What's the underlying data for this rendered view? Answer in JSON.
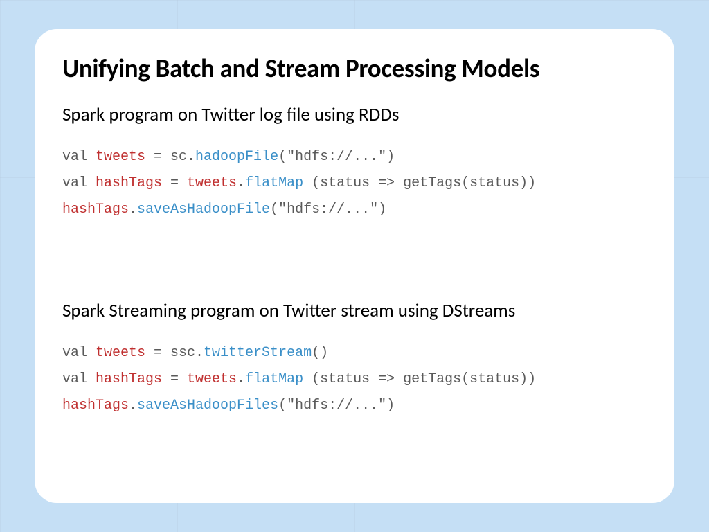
{
  "slide": {
    "title": "Unifying Batch and Stream Processing Models",
    "section1": {
      "subtitle": "Spark program on Twitter log file using RDDs",
      "code": {
        "line1": {
          "p1": "val ",
          "red1": "tweets",
          "p2": " = sc.",
          "blue1": "hadoopFile",
          "p3": "(\"hdfs://...\")"
        },
        "line2": {
          "p1": "val ",
          "red1": "hashTags",
          "p2": " = ",
          "red2": "tweets",
          "p3": ".",
          "blue1": "flatMap",
          "p4": " (status => getTags(status))"
        },
        "line3": {
          "red1": "hashTags",
          "p1": ".",
          "blue1": "saveAsHadoopFile",
          "p2": "(\"hdfs://...\")"
        }
      }
    },
    "section2": {
      "subtitle": "Spark Streaming program on Twitter stream using DStreams",
      "code": {
        "line1": {
          "p1": "val ",
          "red1": "tweets",
          "p2": " = ssc.",
          "blue1": "twitterStream",
          "p3": "()"
        },
        "line2": {
          "p1": "val ",
          "red1": "hashTags",
          "p2": " = ",
          "red2": "tweets",
          "p3": ".",
          "blue1": "flatMap",
          "p4": " (status => getTags(status))"
        },
        "line3": {
          "red1": "hashTags",
          "p1": ".",
          "blue1": "saveAsHadoopFiles",
          "p2": "(\"hdfs://...\")"
        }
      }
    }
  }
}
